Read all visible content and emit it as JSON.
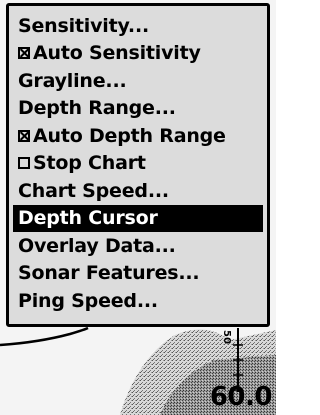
{
  "menu": {
    "items": [
      {
        "label": "Sensitivity...",
        "checkbox": null,
        "selected": false
      },
      {
        "label": "Auto Sensitivity",
        "checkbox": "checked",
        "selected": false
      },
      {
        "label": "Grayline...",
        "checkbox": null,
        "selected": false
      },
      {
        "label": "Depth Range...",
        "checkbox": null,
        "selected": false
      },
      {
        "label": "Auto Depth Range",
        "checkbox": "checked",
        "selected": false
      },
      {
        "label": "Stop Chart",
        "checkbox": "unchecked",
        "selected": false
      },
      {
        "label": "Chart Speed...",
        "checkbox": null,
        "selected": false
      },
      {
        "label": "Depth Cursor",
        "checkbox": null,
        "selected": true
      },
      {
        "label": "Overlay Data...",
        "checkbox": null,
        "selected": false
      },
      {
        "label": "Sonar Features...",
        "checkbox": null,
        "selected": false
      },
      {
        "label": "Ping Speed...",
        "checkbox": null,
        "selected": false
      }
    ]
  },
  "sonar": {
    "depth_readout": "60.0",
    "scale_label": "50"
  },
  "colors": {
    "menu_background": "#dcdcdc",
    "menu_border": "#000000",
    "selected_background": "#000000",
    "selected_text": "#ffffff"
  }
}
